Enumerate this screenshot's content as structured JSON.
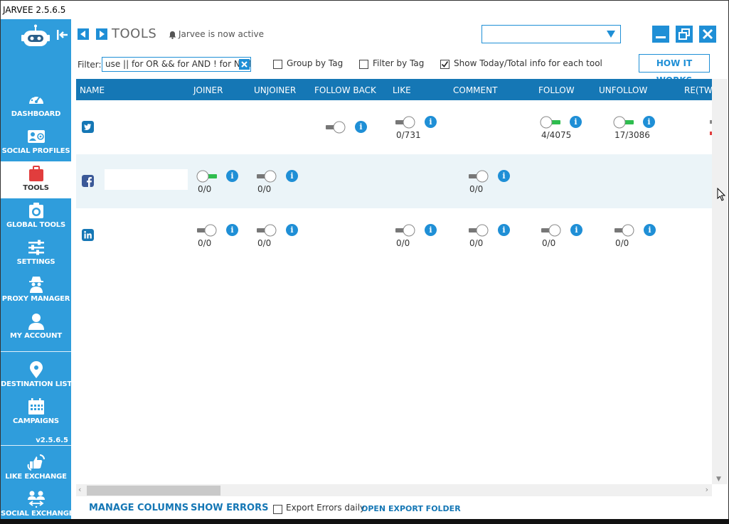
{
  "window": {
    "title": "JARVEE 2.5.6.5"
  },
  "sidebar": {
    "items": [
      {
        "id": "dashboard",
        "label": "DASHBOARD",
        "icon": "dashboard-gauge-icon"
      },
      {
        "id": "social-profiles",
        "label": "SOCIAL PROFILES",
        "icon": "profiles-icon"
      },
      {
        "id": "tools",
        "label": "TOOLS",
        "icon": "toolbox-icon",
        "active": true
      },
      {
        "id": "global-tools",
        "label": "GLOBAL TOOLS",
        "icon": "global-tools-icon"
      },
      {
        "id": "settings",
        "label": "SETTINGS",
        "icon": "sliders-icon"
      },
      {
        "id": "proxy-manager",
        "label": "PROXY MANAGER",
        "icon": "spy-icon"
      },
      {
        "id": "my-account",
        "label": "MY ACCOUNT",
        "icon": "user-icon"
      },
      {
        "id": "destination-lists",
        "label": "DESTINATION LISTS",
        "icon": "map-pin-icon"
      },
      {
        "id": "campaigns",
        "label": "CAMPAIGNS",
        "icon": "calendar-icon"
      },
      {
        "id": "like-exchange",
        "label": "LIKE EXCHANGE",
        "icon": "like-exchange-icon"
      },
      {
        "id": "social-exchange",
        "label": "SOCIAL EXCHANGE",
        "icon": "social-exchange-icon"
      }
    ],
    "version": "v2.5.6.5"
  },
  "header": {
    "title": "TOOLS",
    "status": "Jarvee is now active"
  },
  "filter": {
    "label": "Filter:",
    "value": "use || for OR && for AND ! for NOT",
    "group_by_tag": {
      "label": "Group by Tag",
      "checked": false
    },
    "filter_by_tag": {
      "label": "Filter by Tag",
      "checked": false
    },
    "show_today_total": {
      "label": "Show Today/Total info for each tool",
      "checked": true
    },
    "how_it_works": "HOW IT WORKS"
  },
  "table": {
    "columns": [
      "NAME",
      "JOINER",
      "UNJOINER",
      "FOLLOW BACK",
      "LIKE",
      "COMMENT",
      "FOLLOW",
      "UNFOLLOW",
      "RE(TW"
    ],
    "rows": [
      {
        "network": "twitter",
        "cells": {
          "follow_back": {
            "on": false
          },
          "like": {
            "on": false,
            "count": "0/731"
          },
          "follow": {
            "on": true,
            "count": "4/4075"
          },
          "unfollow": {
            "on": true,
            "count": "17/3086"
          }
        }
      },
      {
        "network": "facebook",
        "cells": {
          "joiner": {
            "on": true,
            "count": "0/0"
          },
          "unjoiner": {
            "on": false,
            "count": "0/0"
          },
          "comment": {
            "on": false,
            "count": "0/0"
          }
        }
      },
      {
        "network": "linkedin",
        "cells": {
          "joiner": {
            "on": false,
            "count": "0/0"
          },
          "unjoiner": {
            "on": false,
            "count": "0/0"
          },
          "like": {
            "on": false,
            "count": "0/0"
          },
          "comment": {
            "on": false,
            "count": "0/0"
          },
          "follow": {
            "on": false,
            "count": "0/0"
          },
          "unfollow": {
            "on": false,
            "count": "0/0"
          }
        }
      }
    ]
  },
  "footer": {
    "manage_columns": "MANAGE COLUMNS",
    "show_errors": "SHOW ERRORS",
    "export_errors_daily": {
      "label": "Export Errors daily",
      "checked": false
    },
    "open_export_folder": "OPEN EXPORT FOLDER"
  },
  "colors": {
    "sidebar": "#2f9ddc",
    "accent": "#1f8fd6",
    "table_header": "#1577b5",
    "toggle_on": "#2ebd4e",
    "toggle_off": "#777777",
    "row_alt": "#ebf4f8"
  }
}
